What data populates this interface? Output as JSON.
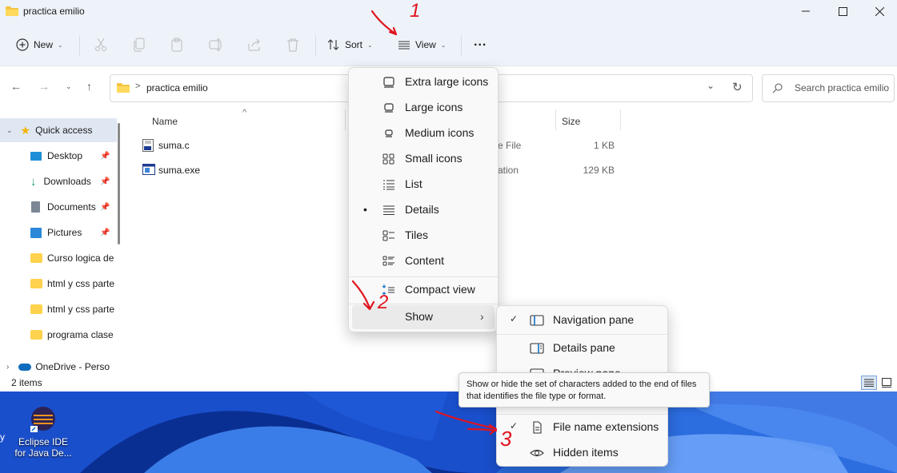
{
  "window": {
    "title": "practica emilio"
  },
  "toolbar": {
    "new_label": "New",
    "sort_label": "Sort",
    "view_label": "View",
    "more_label": "..."
  },
  "address": {
    "path_sep": ">",
    "path": "practica emilio",
    "search_placeholder": "Search practica emilio"
  },
  "sidebar": {
    "quick_access": "Quick access",
    "items": [
      {
        "label": "Desktop"
      },
      {
        "label": "Downloads"
      },
      {
        "label": "Documents"
      },
      {
        "label": "Pictures"
      },
      {
        "label": "Curso logica de"
      },
      {
        "label": "html y css parte"
      },
      {
        "label": "html y css parte"
      },
      {
        "label": "programa clase"
      }
    ],
    "onedrive": "OneDrive - Perso"
  },
  "columns": {
    "name": "Name",
    "size": "Size"
  },
  "files": [
    {
      "name": "suma.c",
      "type_partial": "e File",
      "size": "1 KB"
    },
    {
      "name": "suma.exe",
      "type_partial": "ation",
      "size": "129 KB"
    }
  ],
  "status": {
    "count": "2 items"
  },
  "view_menu": {
    "items": [
      {
        "label": "Extra large icons",
        "icon": "extra-large-icons-icon"
      },
      {
        "label": "Large icons",
        "icon": "large-icons-icon"
      },
      {
        "label": "Medium icons",
        "icon": "medium-icons-icon"
      },
      {
        "label": "Small icons",
        "icon": "small-icons-icon"
      },
      {
        "label": "List",
        "icon": "list-icon"
      },
      {
        "label": "Details",
        "icon": "details-icon",
        "selected_marker": "•"
      },
      {
        "label": "Tiles",
        "icon": "tiles-icon"
      },
      {
        "label": "Content",
        "icon": "content-icon"
      }
    ],
    "compact": "Compact view",
    "show": "Show"
  },
  "show_menu": {
    "items": [
      {
        "label": "Navigation pane",
        "checked": true
      },
      {
        "label": "Details pane",
        "checked": false
      },
      {
        "label": "Preview pane",
        "checked": false
      },
      {
        "label": "File name extensions",
        "checked": true
      },
      {
        "label": "Hidden items",
        "checked": false
      }
    ],
    "check_glyph": "✓"
  },
  "tooltip": {
    "text": "Show or hide the set of characters added to the end of files that identifies the file type or format."
  },
  "desktop": {
    "icon_label": "Eclipse IDE for Java De...",
    "edge_glyph": "y"
  },
  "annotations": {
    "one": "1",
    "two": "2",
    "three": "3"
  },
  "colors": {
    "accent": "#0067c0",
    "titlebar": "#eef3fa",
    "annotation": "#e0141e"
  }
}
